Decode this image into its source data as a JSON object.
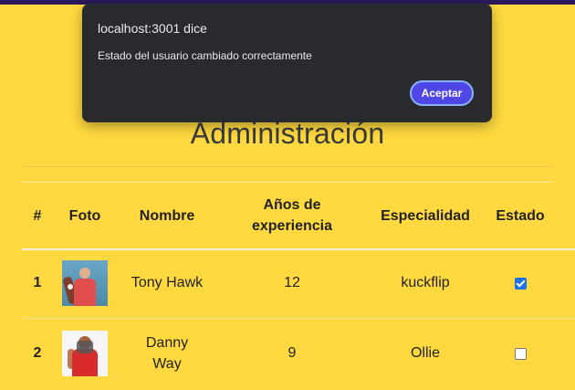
{
  "page": {
    "title": "Administración"
  },
  "table": {
    "headers": {
      "num": "#",
      "photo": "Foto",
      "name": "Nombre",
      "years_line1": "Años de",
      "years_line2": "experiencia",
      "specialty": "Especialidad",
      "state": "Estado"
    },
    "rows": [
      {
        "num": "1",
        "name": "Tony Hawk",
        "years": "12",
        "specialty": "kuckflip",
        "active": true
      },
      {
        "num": "2",
        "name_line1": "Danny",
        "name_line2": "Way",
        "years": "9",
        "specialty": "Ollie",
        "active": false
      }
    ]
  },
  "dialog": {
    "origin": "localhost:3001 dice",
    "message": "Estado del usuario cambiado correctamente",
    "ok_label": "Aceptar"
  },
  "colors": {
    "background": "#ffd93f",
    "dialog_bg": "#292a2d",
    "dialog_button": "#4f46e5",
    "checkbox_checked": "#1a73e8"
  }
}
